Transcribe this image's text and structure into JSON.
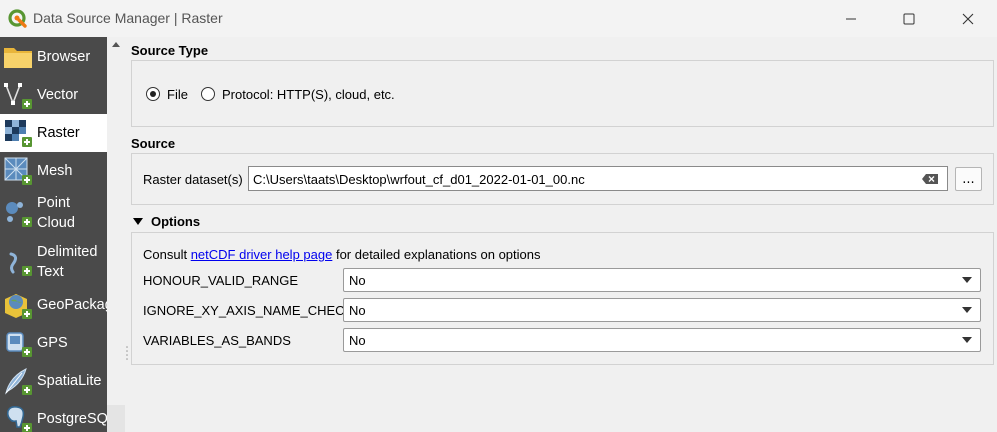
{
  "window": {
    "title": "Data Source Manager | Raster"
  },
  "sidebar": {
    "items": [
      {
        "label": "Browser",
        "icon": "folder-icon"
      },
      {
        "label": "Vector",
        "icon": "vector-icon"
      },
      {
        "label": "Raster",
        "icon": "raster-icon",
        "active": true
      },
      {
        "label": "Mesh",
        "icon": "mesh-icon"
      },
      {
        "label_line1": "Point",
        "label_line2": "Cloud",
        "icon": "point-cloud-icon"
      },
      {
        "label_line1": "Delimited",
        "label_line2": "Text",
        "icon": "delimited-text-icon"
      },
      {
        "label": "GeoPackage",
        "icon": "geopackage-icon"
      },
      {
        "label": "GPS",
        "icon": "gps-icon"
      },
      {
        "label": "SpatiaLite",
        "icon": "spatialite-icon"
      },
      {
        "label": "PostgreSQL",
        "icon": "postgresql-icon"
      }
    ]
  },
  "source_type": {
    "title": "Source Type",
    "file_label": "File",
    "protocol_label": "Protocol: HTTP(S), cloud, etc.",
    "selected": "File"
  },
  "source": {
    "title": "Source",
    "dataset_label": "Raster dataset(s)",
    "dataset_value": "C:\\Users\\taats\\Desktop\\wrfout_cf_d01_2022-01-01_00.nc",
    "browse_label": "..."
  },
  "options": {
    "title": "Options",
    "consult_prefix": "Consult ",
    "link_text": "netCDF driver help page",
    "consult_suffix": " for detailed explanations on options",
    "rows": [
      {
        "name": "HONOUR_VALID_RANGE",
        "value": "No"
      },
      {
        "name": "IGNORE_XY_AXIS_NAME_CHECKS",
        "value": "No"
      },
      {
        "name": "VARIABLES_AS_BANDS",
        "value": "No"
      }
    ]
  },
  "colors": {
    "sidebar_bg": "#4a4a4a",
    "window_bg": "#f0f0f0",
    "qgis_green": "#589632",
    "link": "#0000ee"
  }
}
